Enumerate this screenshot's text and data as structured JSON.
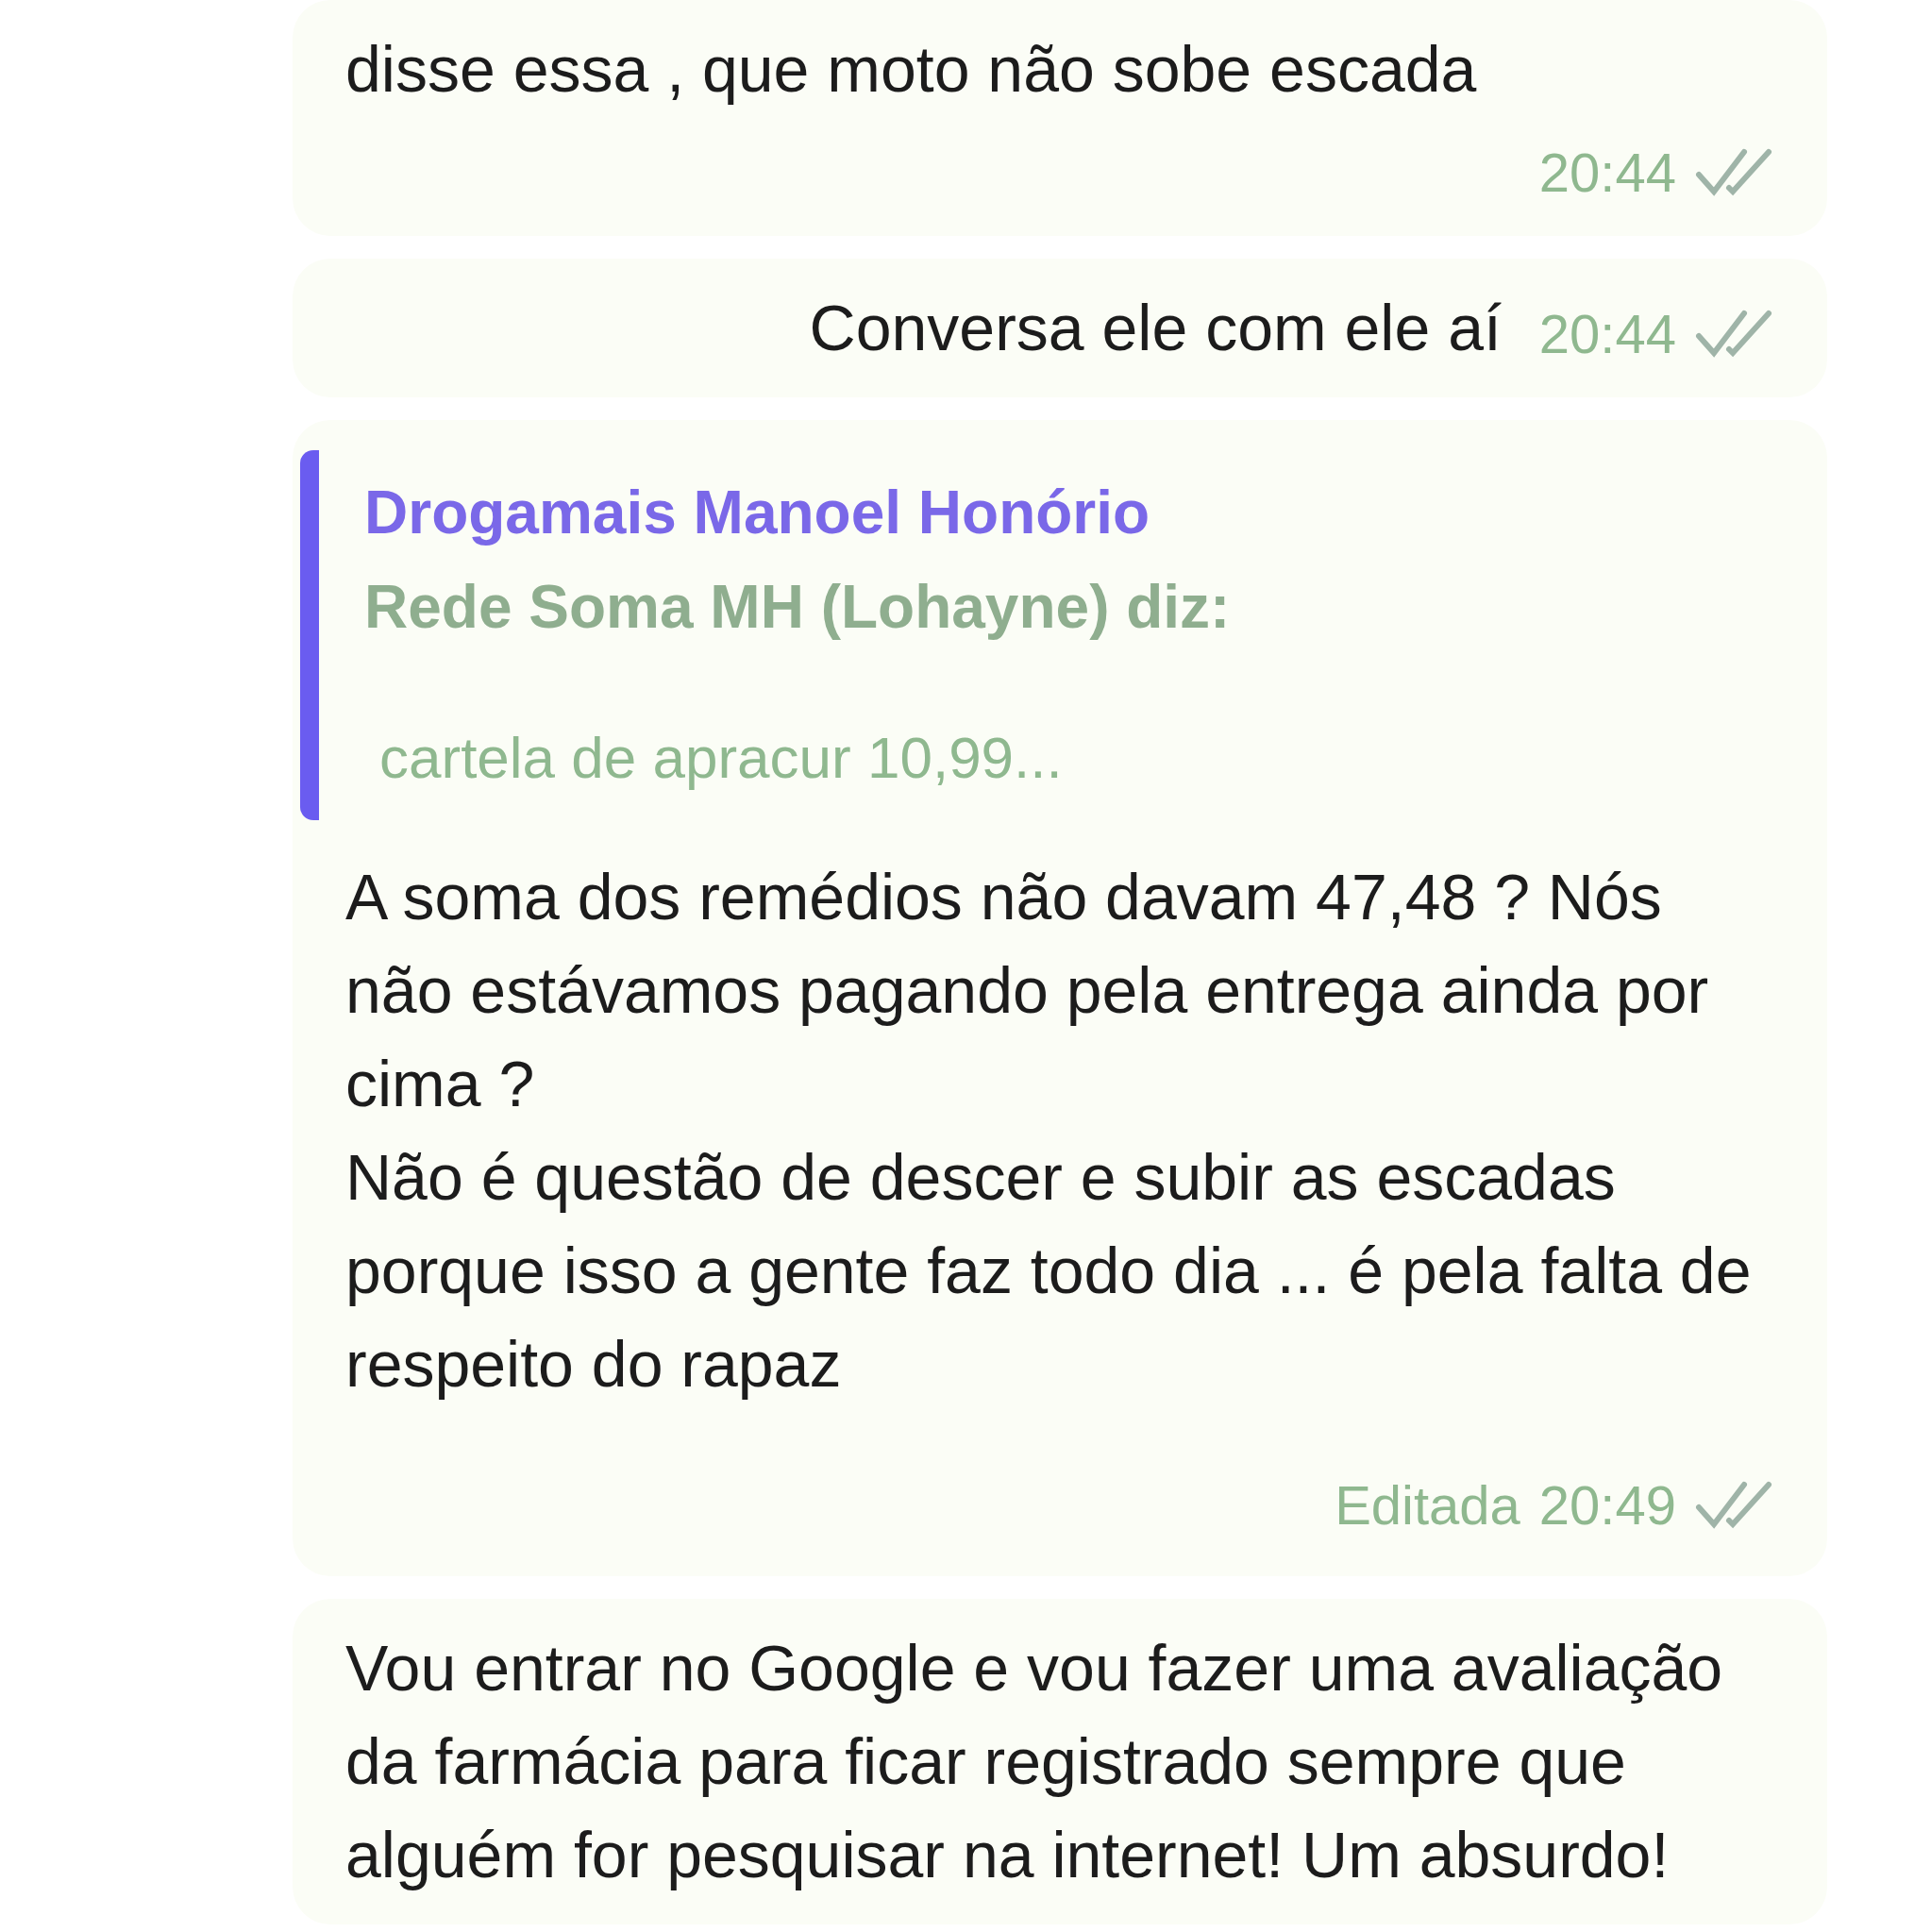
{
  "messages": [
    {
      "kind": "text",
      "paragraphs": [
        "disse essa , que moto não sobe escada"
      ],
      "time": "20:44",
      "read": true
    },
    {
      "kind": "inline",
      "paragraphs": [
        "Conversa ele com ele aí"
      ],
      "time": "20:44",
      "read": true
    },
    {
      "kind": "reply",
      "quote": {
        "group": "Drogamais Manoel Honório",
        "author": "Rede Soma MH (Lohayne) diz:",
        "snippet": "cartela de apracur 10,99..."
      },
      "paragraphs": [
        "A soma dos remédios não davam 47,48 ? Nós não estávamos pagando pela entrega ainda por cima ?",
        "Não é questão de descer e subir as escadas porque isso a gente faz todo dia ... é pela falta de respeito do rapaz"
      ],
      "edited": "Editada",
      "time": "20:49",
      "read": true
    },
    {
      "kind": "text",
      "paragraphs": [
        "Vou entrar no Google e vou fazer uma avaliação da farmácia para ficar registrado sempre que alguém for pesquisar na internet! Um absurdo!"
      ]
    }
  ]
}
